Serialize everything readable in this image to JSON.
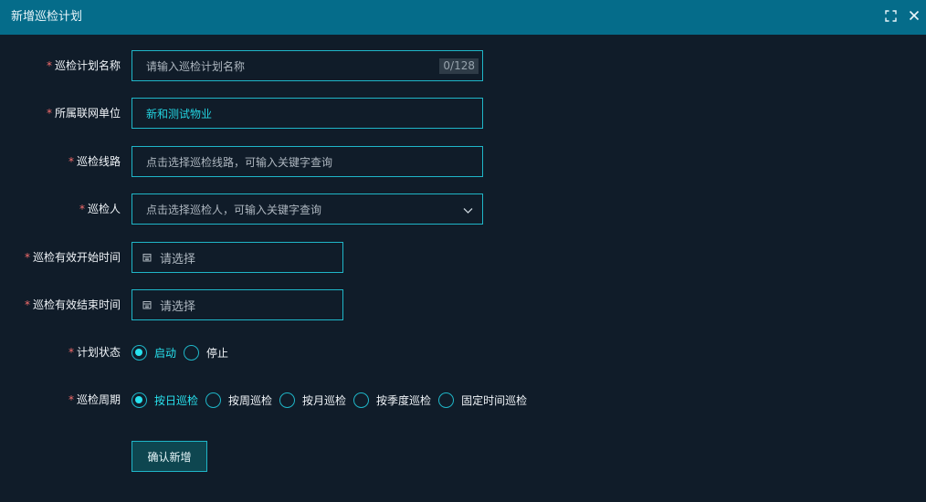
{
  "window": {
    "title": "新增巡检计划",
    "icons": {
      "maximize": "fullscreen-icon",
      "close": "close-icon"
    }
  },
  "form": {
    "plan_name": {
      "label": "巡检计划名称",
      "placeholder": "请输入巡检计划名称",
      "counter": "0/128"
    },
    "unit": {
      "label": "所属联网单位",
      "value": "新和测试物业"
    },
    "route": {
      "label": "巡检线路",
      "placeholder": "点击选择巡检线路，可输入关键字查询"
    },
    "inspector": {
      "label": "巡检人",
      "placeholder": "点击选择巡检人，可输入关键字查询"
    },
    "start_time": {
      "label": "巡检有效开始时间",
      "placeholder": "请选择"
    },
    "end_time": {
      "label": "巡检有效结束时间",
      "placeholder": "请选择"
    },
    "status": {
      "label": "计划状态",
      "options": [
        {
          "label": "启动",
          "checked": true
        },
        {
          "label": "停止",
          "checked": false
        }
      ]
    },
    "cycle": {
      "label": "巡检周期",
      "options": [
        {
          "label": "按日巡检",
          "checked": true
        },
        {
          "label": "按周巡检",
          "checked": false
        },
        {
          "label": "按月巡检",
          "checked": false
        },
        {
          "label": "按季度巡检",
          "checked": false
        },
        {
          "label": "固定时间巡检",
          "checked": false
        }
      ]
    },
    "required_mark": "*",
    "submit_label": "确认新增"
  },
  "colors": {
    "accent": "#1fb6c8",
    "checked": "#28e2ee",
    "titlebar": "#056c8a",
    "background": "#101c29",
    "required": "#f56c6c"
  }
}
